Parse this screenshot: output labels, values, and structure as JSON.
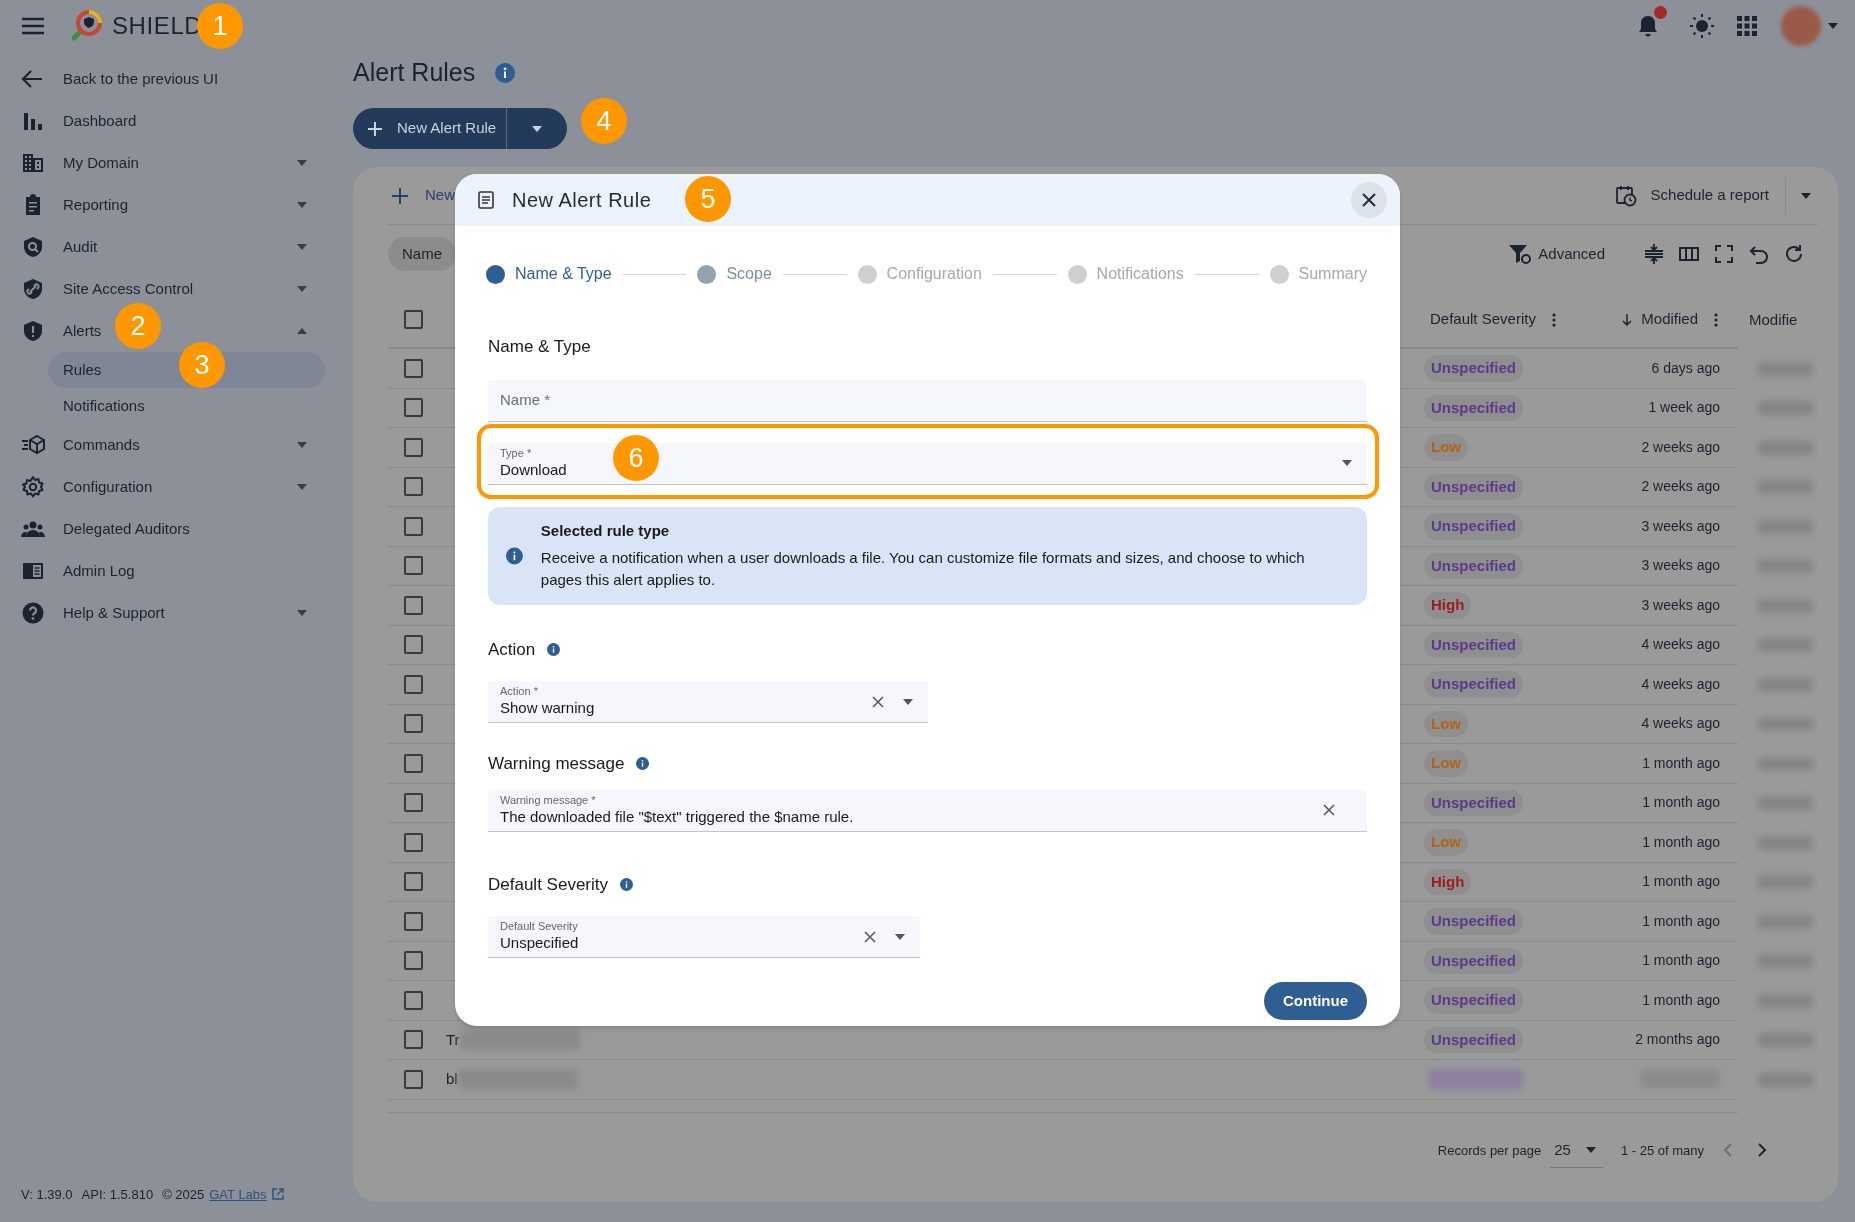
{
  "app": {
    "name": "SHIELD"
  },
  "top_bar": {
    "notifications_unread": true
  },
  "sidebar": {
    "back_link": "Back to the previous UI",
    "items": [
      {
        "label": "Dashboard"
      },
      {
        "label": "My Domain",
        "expanded": false
      },
      {
        "label": "Reporting",
        "expanded": false
      },
      {
        "label": "Audit",
        "expanded": false
      },
      {
        "label": "Site Access Control",
        "expanded": false
      },
      {
        "label": "Alerts",
        "expanded": true,
        "children": [
          {
            "label": "Rules",
            "selected": true
          },
          {
            "label": "Notifications",
            "selected": false
          }
        ]
      },
      {
        "label": "Commands",
        "expanded": false
      },
      {
        "label": "Configuration",
        "expanded": false
      },
      {
        "label": "Delegated Auditors"
      },
      {
        "label": "Admin Log"
      },
      {
        "label": "Help & Support",
        "expanded": false
      }
    ]
  },
  "page": {
    "title": "Alert Rules",
    "new_button": "New Alert Rule"
  },
  "card": {
    "select_all_checked": false,
    "toolbar_new": "New",
    "schedule_button": "Schedule a report",
    "filter_chip": "Name",
    "advanced_button": "Advanced",
    "columns": [
      {
        "label": "Default Severity",
        "sorted": false,
        "menu": true
      },
      {
        "label": "Modified",
        "sorted": true,
        "menu": true
      },
      {
        "label": "Modifie",
        "sorted": false,
        "menu": false
      }
    ],
    "rows": [
      {
        "checked": false,
        "severity": "Unspecified",
        "color": "#5b3a8c",
        "modified": "6 days ago"
      },
      {
        "checked": false,
        "severity": "Unspecified",
        "color": "#5b3a8c",
        "modified": "1 week ago"
      },
      {
        "checked": false,
        "severity": "Low",
        "color": "#b4640f",
        "modified": "2 weeks ago"
      },
      {
        "checked": false,
        "severity": "Unspecified",
        "color": "#5b3a8c",
        "modified": "2 weeks ago"
      },
      {
        "checked": false,
        "severity": "Unspecified",
        "color": "#5b3a8c",
        "modified": "3 weeks ago"
      },
      {
        "checked": false,
        "severity": "Unspecified",
        "color": "#5b3a8c",
        "modified": "3 weeks ago"
      },
      {
        "checked": false,
        "severity": "High",
        "color": "#9e1b1b",
        "modified": "3 weeks ago"
      },
      {
        "checked": false,
        "severity": "Unspecified",
        "color": "#5b3a8c",
        "modified": "4 weeks ago"
      },
      {
        "checked": false,
        "severity": "Unspecified",
        "color": "#5b3a8c",
        "modified": "4 weeks ago"
      },
      {
        "checked": false,
        "severity": "Low",
        "color": "#b4640f",
        "modified": "4 weeks ago"
      },
      {
        "checked": false,
        "severity": "Low",
        "color": "#b4640f",
        "modified": "1 month ago"
      },
      {
        "checked": false,
        "severity": "Unspecified",
        "color": "#5b3a8c",
        "modified": "1 month ago"
      },
      {
        "checked": false,
        "severity": "Low",
        "color": "#b4640f",
        "modified": "1 month ago"
      },
      {
        "checked": false,
        "severity": "High",
        "color": "#9e1b1b",
        "modified": "1 month ago"
      },
      {
        "checked": false,
        "severity": "Unspecified",
        "color": "#5b3a8c",
        "modified": "1 month ago"
      },
      {
        "checked": false,
        "severity": "Unspecified",
        "color": "#5b3a8c",
        "modified": "1 month ago"
      },
      {
        "checked": false,
        "severity": "Unspecified",
        "color": "#5b3a8c",
        "modified": "1 month ago"
      },
      {
        "checked": false,
        "name": "Tr",
        "severity": "Unspecified",
        "color": "#5b3a8c",
        "modified": "2 months ago"
      },
      {
        "checked": false,
        "name": "bl"
      }
    ],
    "pagination": {
      "label": "Records per page",
      "per_page": "25",
      "range": "1 - 25 of many"
    }
  },
  "dialog": {
    "title": "New Alert Rule",
    "steps": [
      {
        "label": "Name & Type",
        "selected": true,
        "disabled": false
      },
      {
        "label": "Scope",
        "selected": false,
        "disabled": false
      },
      {
        "label": "Configuration",
        "selected": false,
        "disabled": true
      },
      {
        "label": "Notifications",
        "selected": false,
        "disabled": true
      },
      {
        "label": "Summary",
        "selected": false,
        "disabled": true
      }
    ],
    "name_type_heading": "Name & Type",
    "name_field": {
      "placeholder": "Name *"
    },
    "type_field": {
      "label": "Type *",
      "value": "Download",
      "highlighted": true
    },
    "info": {
      "title": "Selected rule type",
      "text": "Receive a notification when a user downloads a file. You can customize file formats and sizes, and choose to which pages this alert applies to."
    },
    "action_heading": "Action",
    "action_field": {
      "label": "Action *",
      "value": "Show warning"
    },
    "warning_heading": "Warning message",
    "warning_field": {
      "label": "Warning message *",
      "value": "The downloaded file \"$text\" triggered the $name rule."
    },
    "severity_heading": "Default Severity",
    "severity_field": {
      "label": "Default Severity",
      "value": "Unspecified"
    },
    "continue_button": "Continue"
  },
  "footer": {
    "version": "V: 1.39.0",
    "api": "API: 1.5.810",
    "copyright": "© 2025",
    "link": "GAT Labs"
  },
  "callouts": [
    "1",
    "2",
    "3",
    "4",
    "5",
    "6"
  ]
}
